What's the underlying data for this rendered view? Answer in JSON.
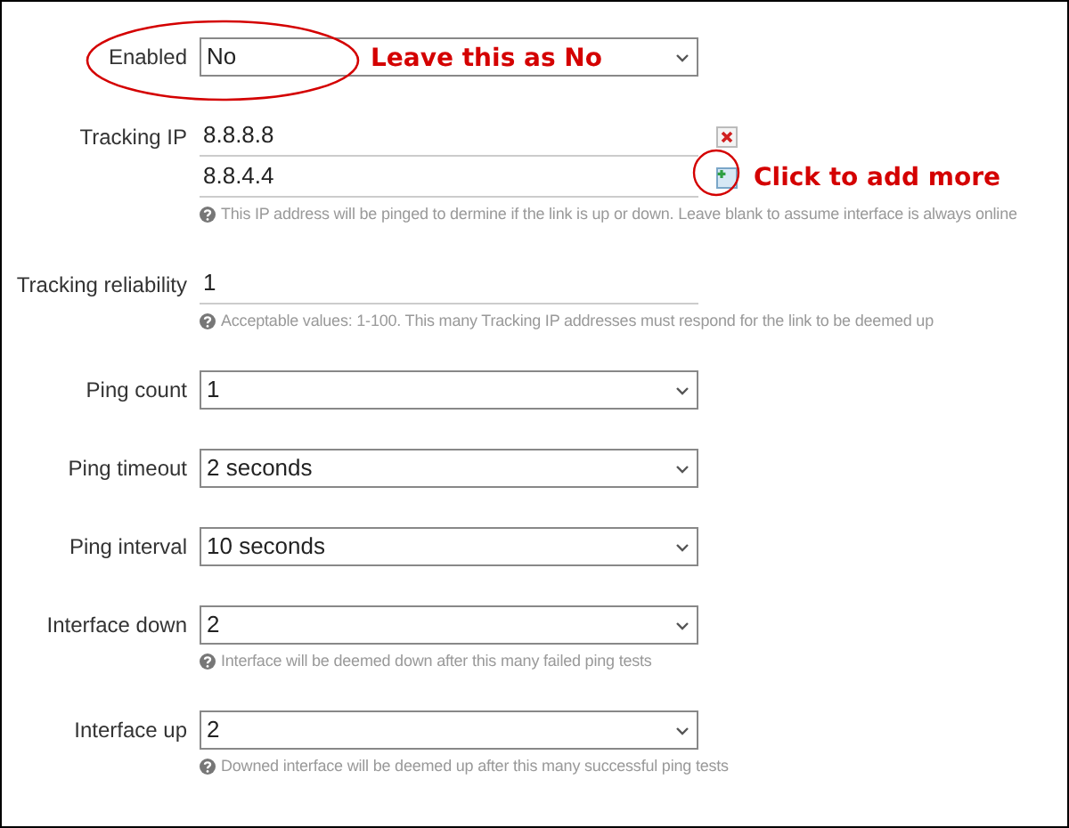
{
  "fields": [
    {
      "kind": "select",
      "label": "Enabled",
      "value": "No",
      "annotation": "Leave this as No"
    },
    {
      "kind": "list",
      "label": "Tracking IP",
      "values": [
        "8.8.8.8",
        "8.8.4.4"
      ],
      "help": "This IP address will be pinged to dermine if the link is up or down. Leave blank to assume interface is always online",
      "annotation": "Click to add more"
    },
    {
      "kind": "text",
      "label": "Tracking reliability",
      "value": "1",
      "help": "Acceptable values: 1-100. This many Tracking IP addresses must respond for the link to be deemed up"
    },
    {
      "kind": "select",
      "label": "Ping count",
      "value": "1"
    },
    {
      "kind": "select",
      "label": "Ping timeout",
      "value": "2 seconds"
    },
    {
      "kind": "select",
      "label": "Ping interval",
      "value": "10 seconds"
    },
    {
      "kind": "select",
      "label": "Interface down",
      "value": "2",
      "help": "Interface will be deemed down after this many failed ping tests"
    },
    {
      "kind": "select",
      "label": "Interface up",
      "value": "2",
      "help": "Downed interface will be deemed up after this many successful ping tests"
    }
  ]
}
